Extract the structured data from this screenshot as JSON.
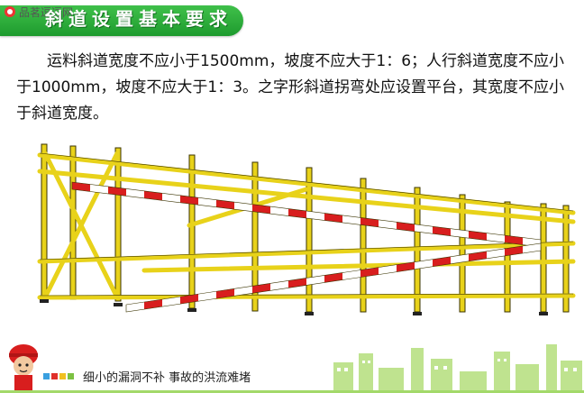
{
  "watermark": {
    "text": "品茗逗逗网"
  },
  "banner": {
    "title": "斜道设置基本要求",
    "color": "#27a638"
  },
  "content": {
    "paragraph": "运料斜道宽度不应小于1500mm，坡度不应大于1：6；人行斜道宽度不应小于1000mm，坡度不应大于1：3。之字形斜道拐弯处应设置平台，其宽度不应小于斜道宽度。"
  },
  "illustration": {
    "subject": "scaffold-ramp",
    "frame_color": "#e8d21a",
    "stripe_colors": [
      "#d81e1e",
      "#ffffff"
    ]
  },
  "footer": {
    "slogan": "细小的漏洞不补  事故的洪流难堵",
    "square_colors": [
      "#3aa0e0",
      "#e0302a",
      "#f0c020",
      "#7cc142"
    ],
    "skyline_color": "#a3d96a"
  }
}
